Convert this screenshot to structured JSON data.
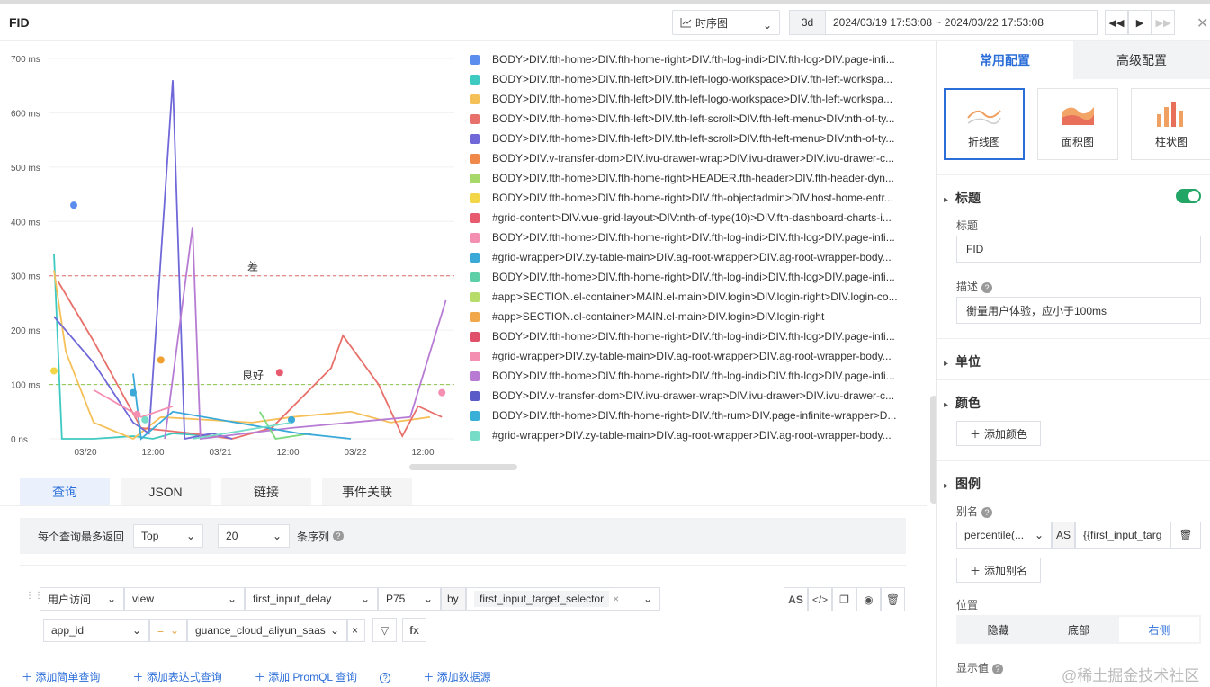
{
  "header": {
    "title": "FID",
    "chart_type": "时序图",
    "quick_range": "3d",
    "time_range": "2024/03/19 17:53:08 ~ 2024/03/22 17:53:08"
  },
  "chart_data": {
    "type": "line",
    "y_unit": "ms",
    "ylim": [
      0,
      700
    ],
    "y_ticks": [
      "700 ms",
      "600 ms",
      "500 ms",
      "400 ms",
      "300 ms",
      "200 ms",
      "100 ms",
      "0 ns"
    ],
    "x_ticks": [
      "03/20",
      "12:00",
      "03/21",
      "12:00",
      "03/22",
      "12:00"
    ],
    "thresholds": [
      {
        "label": "差",
        "value": 300,
        "color": "#e06c6c"
      },
      {
        "label": "良好",
        "value": 100,
        "color": "#8bc34a"
      }
    ],
    "series": [
      {
        "color": "#5b8def",
        "values": [],
        "dots": [
          [
            0.05,
            430
          ]
        ]
      },
      {
        "color": "#3ec9c1",
        "values": [
          [
            0.0,
            340
          ],
          [
            0.02,
            0
          ],
          [
            0.1,
            0
          ],
          [
            0.2,
            5
          ],
          [
            0.25,
            0
          ],
          [
            0.3,
            10
          ],
          [
            0.4,
            5
          ]
        ]
      },
      {
        "color": "#f6c058",
        "values": [
          [
            0.0,
            310
          ],
          [
            0.03,
            160
          ],
          [
            0.1,
            30
          ],
          [
            0.2,
            0
          ],
          [
            0.27,
            40
          ],
          [
            0.5,
            30
          ],
          [
            0.6,
            40
          ],
          [
            0.75,
            50
          ],
          [
            0.85,
            30
          ],
          [
            0.95,
            40
          ]
        ]
      },
      {
        "color": "#e8706a",
        "values": [
          [
            0.01,
            290
          ],
          [
            0.1,
            180
          ],
          [
            0.22,
            20
          ],
          [
            0.35,
            10
          ],
          [
            0.45,
            0
          ],
          [
            0.55,
            20
          ],
          [
            0.7,
            130
          ],
          [
            0.73,
            190
          ],
          [
            0.82,
            100
          ],
          [
            0.88,
            5
          ],
          [
            0.92,
            60
          ],
          [
            0.98,
            40
          ]
        ]
      },
      {
        "color": "#7068d8",
        "values": [
          [
            0.0,
            225
          ],
          [
            0.1,
            140
          ],
          [
            0.2,
            30
          ],
          [
            0.24,
            10
          ],
          [
            0.3,
            660
          ],
          [
            0.33,
            0
          ],
          [
            0.4,
            10
          ],
          [
            0.45,
            0
          ]
        ]
      },
      {
        "color": "#b77bd3",
        "values": [
          [
            0.28,
            0
          ],
          [
            0.35,
            390
          ],
          [
            0.37,
            0
          ],
          [
            0.6,
            20
          ],
          [
            0.9,
            40
          ],
          [
            0.99,
            255
          ]
        ]
      },
      {
        "color": "#7ad97a",
        "values": [
          [
            0.52,
            50
          ],
          [
            0.56,
            0
          ],
          [
            0.65,
            10
          ]
        ]
      },
      {
        "color": "#3aa9d8",
        "values": [
          [
            0.2,
            120
          ],
          [
            0.22,
            0
          ],
          [
            0.3,
            50
          ],
          [
            0.62,
            10
          ],
          [
            0.75,
            0
          ]
        ],
        "dots": [
          [
            0.2,
            85
          ],
          [
            0.6,
            35
          ]
        ]
      },
      {
        "color": "#f48fb1",
        "values": [
          [
            0.1,
            90
          ],
          [
            0.22,
            40
          ],
          [
            0.3,
            60
          ]
        ],
        "dots": [
          [
            0.98,
            85
          ],
          [
            0.21,
            45
          ]
        ]
      },
      {
        "color": "#f0a030",
        "values": [],
        "dots": [
          [
            0.27,
            145
          ]
        ]
      },
      {
        "color": "#e85a6e",
        "values": [],
        "dots": [
          [
            0.57,
            122
          ]
        ]
      },
      {
        "color": "#f2d648",
        "values": [],
        "dots": [
          [
            0.0,
            125
          ]
        ]
      },
      {
        "color": "#76dcc8",
        "values": [
          [
            0.35,
            0
          ],
          [
            0.6,
            30
          ]
        ],
        "dots": [
          [
            0.23,
            35
          ]
        ]
      }
    ]
  },
  "legend": [
    {
      "label": "BODY>DIV.fth-home>DIV.fth-home-right>DIV.fth-log-indi>DIV.fth-log>DIV.page-infi...",
      "color": "#5b8def"
    },
    {
      "label": "BODY>DIV.fth-home>DIV.fth-left>DIV.fth-left-logo-workspace>DIV.fth-left-workspa...",
      "color": "#3ec9c1"
    },
    {
      "label": "BODY>DIV.fth-home>DIV.fth-left>DIV.fth-left-logo-workspace>DIV.fth-left-workspa...",
      "color": "#f6c058"
    },
    {
      "label": "BODY>DIV.fth-home>DIV.fth-left>DIV.fth-left-scroll>DIV.fth-left-menu>DIV:nth-of-ty...",
      "color": "#e8706a"
    },
    {
      "label": "BODY>DIV.fth-home>DIV.fth-left>DIV.fth-left-scroll>DIV.fth-left-menu>DIV:nth-of-ty...",
      "color": "#7068d8"
    },
    {
      "label": "BODY>DIV.v-transfer-dom>DIV.ivu-drawer-wrap>DIV.ivu-drawer>DIV.ivu-drawer-c...",
      "color": "#f0884a"
    },
    {
      "label": "BODY>DIV.fth-home>DIV.fth-home-right>HEADER.fth-header>DIV.fth-header-dyn...",
      "color": "#a6d96a"
    },
    {
      "label": "BODY>DIV.fth-home>DIV.fth-home-right>DIV.fth-objectadmin>DIV.host-home-entr...",
      "color": "#f2d648"
    },
    {
      "label": "#grid-content>DIV.vue-grid-layout>DIV:nth-of-type(10)>DIV.fth-dashboard-charts-i...",
      "color": "#e85a6e"
    },
    {
      "label": "BODY>DIV.fth-home>DIV.fth-home-right>DIV.fth-log-indi>DIV.fth-log>DIV.page-infi...",
      "color": "#f48fb1"
    },
    {
      "label": "#grid-wrapper>DIV.zy-table-main>DIV.ag-root-wrapper>DIV.ag-root-wrapper-body...",
      "color": "#3aa9d8"
    },
    {
      "label": "BODY>DIV.fth-home>DIV.fth-home-right>DIV.fth-log-indi>DIV.fth-log>DIV.page-infi...",
      "color": "#5dd0a8"
    },
    {
      "label": "#app>SECTION.el-container>MAIN.el-main>DIV.login>DIV.login-right>DIV.login-co...",
      "color": "#b8dc6a"
    },
    {
      "label": "#app>SECTION.el-container>MAIN.el-main>DIV.login>DIV.login-right",
      "color": "#f0a84a"
    },
    {
      "label": "BODY>DIV.fth-home>DIV.fth-home-right>DIV.fth-log-indi>DIV.fth-log>DIV.page-infi...",
      "color": "#e05068"
    },
    {
      "label": "#grid-wrapper>DIV.zy-table-main>DIV.ag-root-wrapper>DIV.ag-root-wrapper-body...",
      "color": "#f48fb1"
    },
    {
      "label": "BODY>DIV.fth-home>DIV.fth-home-right>DIV.fth-log-indi>DIV.fth-log>DIV.page-infi...",
      "color": "#b77bd3"
    },
    {
      "label": "BODY>DIV.v-transfer-dom>DIV.ivu-drawer-wrap>DIV.ivu-drawer>DIV.ivu-drawer-c...",
      "color": "#5a5ac8"
    },
    {
      "label": "BODY>DIV.fth-home>DIV.fth-home-right>DIV.fth-rum>DIV.page-infinite-wrapper>D...",
      "color": "#3ab0d8"
    },
    {
      "label": "#grid-wrapper>DIV.zy-table-main>DIV.ag-root-wrapper>DIV.ag-root-wrapper-body...",
      "color": "#76dcc8"
    }
  ],
  "query_tabs": [
    "查询",
    "JSON",
    "链接",
    "事件关联"
  ],
  "query": {
    "limit_label": "每个查询最多返回",
    "limit_mode": "Top",
    "limit_count": "20",
    "limit_suffix": "条序列",
    "source": "用户访问",
    "index": "view",
    "field": "first_input_delay",
    "agg": "P75",
    "by": "by",
    "group": "first_input_target_selector",
    "filter_key": "app_id",
    "filter_op": "=",
    "filter_value": "guance_cloud_aliyun_saas",
    "as_label": "AS",
    "fx_label": "fx"
  },
  "add_links": [
    "添加简单查询",
    "添加表达式查询",
    "添加 PromQL 查询",
    "添加数据源"
  ],
  "right": {
    "tabs": [
      "常用配置",
      "高级配置"
    ],
    "chart_types": [
      "折线图",
      "面积图",
      "柱状图"
    ],
    "title_section": "标题",
    "title_label": "标题",
    "title_value": "FID",
    "desc_label": "描述",
    "desc_value": "衡量用户体验，应小于100ms",
    "unit_section": "单位",
    "color_section": "颜色",
    "add_color": "添加颜色",
    "legend_section": "图例",
    "alias_label": "别名",
    "alias_field": "percentile(...",
    "alias_as": "AS",
    "alias_value": "{{first_input_targ",
    "add_alias": "添加别名",
    "position_label": "位置",
    "positions": [
      "隐藏",
      "底部",
      "右侧"
    ],
    "display_label": "显示值"
  },
  "watermark": "@稀土掘金技术社区"
}
